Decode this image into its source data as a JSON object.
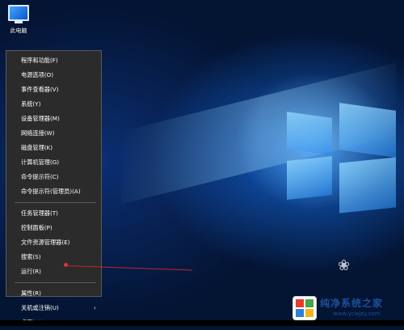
{
  "desktop": {
    "icon_label": "此电脑"
  },
  "menu": {
    "groups": [
      [
        "程序和功能(F)",
        "电源选项(O)",
        "事件查看器(V)",
        "系统(Y)",
        "设备管理器(M)",
        "网络连接(W)",
        "磁盘管理(K)",
        "计算机管理(G)",
        "命令提示符(C)",
        "命令提示符(管理员)(A)"
      ],
      [
        "任务管理器(T)",
        "控制面板(P)",
        "文件资源管理器(E)",
        "搜索(S)",
        "运行(R)"
      ],
      [
        "关机或注销(U)",
        "桌面(D)"
      ]
    ],
    "items": {
      "programs_features": "程序和功能(F)",
      "power_options": "电源选项(O)",
      "event_viewer": "事件查看器(V)",
      "system": "系统(Y)",
      "device_manager": "设备管理器(M)",
      "network_connections": "网络连接(W)",
      "disk_management": "磁盘管理(K)",
      "computer_management": "计算机管理(G)",
      "command_prompt": "命令提示符(C)",
      "command_prompt_admin": "命令提示符(管理员)(A)",
      "task_manager": "任务管理器(T)",
      "control_panel": "控制面板(P)",
      "file_explorer": "文件资源管理器(E)",
      "search": "搜索(S)",
      "run": "运行(R)",
      "properties": "属性(R)",
      "shutdown_signout": "关机或注销(U)",
      "desktop": "桌面(D)"
    },
    "submenu_arrow": "›"
  },
  "watermark": {
    "title": "纯净系统之家",
    "url": "www.ycwjzy.com"
  },
  "colors": {
    "menu_bg": "#2b2b2b",
    "menu_text": "#ffffff",
    "highlight_line": "#c0262e",
    "watermark_text": "#1c4f9a"
  }
}
